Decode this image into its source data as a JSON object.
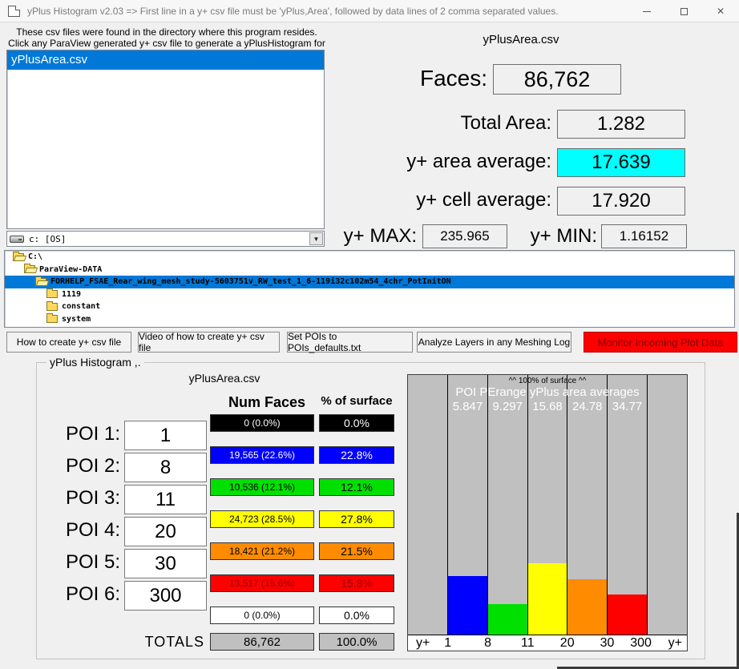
{
  "window": {
    "title": "yPlus Histogram v2.03 => First line in a y+ csv file must be 'yPlus,Area', followed by data lines of 2 comma separated values.",
    "close_glyph": "✕"
  },
  "file_panel": {
    "instructions_line1": "These csv files were found in the directory where this program resides.",
    "instructions_line2": "Click any ParaView generated y+ csv file to generate a yPlusHistogram for it.",
    "files": [
      {
        "name": "yPlusArea.csv",
        "selected": true
      }
    ],
    "drive_combo_value": "c:  [OS]",
    "combo_arrow": "▼"
  },
  "stats": {
    "csv_label": "yPlusArea.csv",
    "faces_label": "Faces:",
    "faces_value": "86,762",
    "total_area_label": "Total Area:",
    "total_area_value": "1.282",
    "area_avg_label": "y+ area average:",
    "area_avg_value": "17.639",
    "cell_avg_label": "y+ cell average:",
    "cell_avg_value": "17.920",
    "max_label": "y+ MAX:",
    "max_value": "235.965",
    "min_label": "y+ MIN:",
    "min_value": "1.16152",
    "area_avg_highlight_color": "#00ffff"
  },
  "directory_tree": {
    "items": [
      {
        "label": "C:\\",
        "state": "open",
        "selected": false
      },
      {
        "label": "ParaView-DATA",
        "state": "open",
        "selected": false
      },
      {
        "label": "FORHELP_FSAE_Rear_wing_mesh_study-5603751v_RW_test_1_6-119i32c102m54_4chr_PotInitON",
        "state": "open",
        "selected": true
      },
      {
        "label": "1119",
        "state": "closed",
        "selected": false
      },
      {
        "label": "constant",
        "state": "closed",
        "selected": false
      },
      {
        "label": "system",
        "state": "closed",
        "selected": false
      }
    ]
  },
  "toolbar": {
    "buttons": [
      {
        "label": "How to create y+ csv file"
      },
      {
        "label": "Video of how to create y+ csv file"
      },
      {
        "label": "Set POIs to POIs_defaults.txt"
      },
      {
        "label": "Analyze Layers in any Meshing Log"
      },
      {
        "label": "Monitor Incoming Plot Data",
        "style": "alert",
        "bg": "#ff0000",
        "fg": "#7b0000"
      }
    ]
  },
  "histogram": {
    "group_title": "yPlus Histogram ,.",
    "csv_label": "yPlusArea.csv",
    "num_faces_header": "Num Faces",
    "pct_surface_header": "% of surface",
    "poi_rows": [
      {
        "label": "POI 1:",
        "value": "1"
      },
      {
        "label": "POI 2:",
        "value": "8"
      },
      {
        "label": "POI 3:",
        "value": "11"
      },
      {
        "label": "POI 4:",
        "value": "20"
      },
      {
        "label": "POI 5:",
        "value": "30"
      },
      {
        "label": "POI 6:",
        "value": "300"
      }
    ],
    "data_rows": [
      {
        "faces": "0 (0.0%)",
        "pct": "0.0%",
        "color": "#000000"
      },
      {
        "faces": "19,565 (22.6%)",
        "pct": "22.8%",
        "color": "#0000ff"
      },
      {
        "faces": "10,536 (12.1%)",
        "pct": "12.1%",
        "color": "#00e000"
      },
      {
        "faces": "24,723 (28.5%)",
        "pct": "27.8%",
        "color": "#ffff00"
      },
      {
        "faces": "18,421 (21.2%)",
        "pct": "21.5%",
        "color": "#ff8c00"
      },
      {
        "faces": "13,517 (15.6%)",
        "pct": "15.8%",
        "color": "#ff0000"
      },
      {
        "faces": "0 (0.0%)",
        "pct": "0.0%",
        "color": "#ffffff"
      }
    ],
    "totals_label": "TOTALS",
    "totals_faces": "86,762",
    "totals_pct": "100.0%"
  },
  "chart_data": {
    "type": "bar",
    "title": "^^ 100% of surface ^^",
    "subtitle": "POI PErange yPlus area averages",
    "range_averages": [
      "5.847",
      "9.297",
      "15.68",
      "24.78",
      "34.77"
    ],
    "x_boundary_labels": [
      "y+",
      "1",
      "8",
      "11",
      "20",
      "30",
      "300",
      "y+"
    ],
    "categories": [
      "<1",
      "1-8",
      "8-11",
      "11-20",
      "20-30",
      "30-300",
      ">300"
    ],
    "series": [
      {
        "name": "% of surface",
        "values": [
          0,
          22.8,
          12.1,
          27.8,
          21.5,
          15.8,
          0
        ]
      }
    ],
    "bar_colors": [
      "none",
      "#0000ff",
      "#00e000",
      "#ffff00",
      "#ff8c00",
      "#ff0000",
      "none"
    ],
    "ylim": [
      0,
      100
    ],
    "plot_bg": "#c0c0c0",
    "grid": "column-dividers"
  }
}
